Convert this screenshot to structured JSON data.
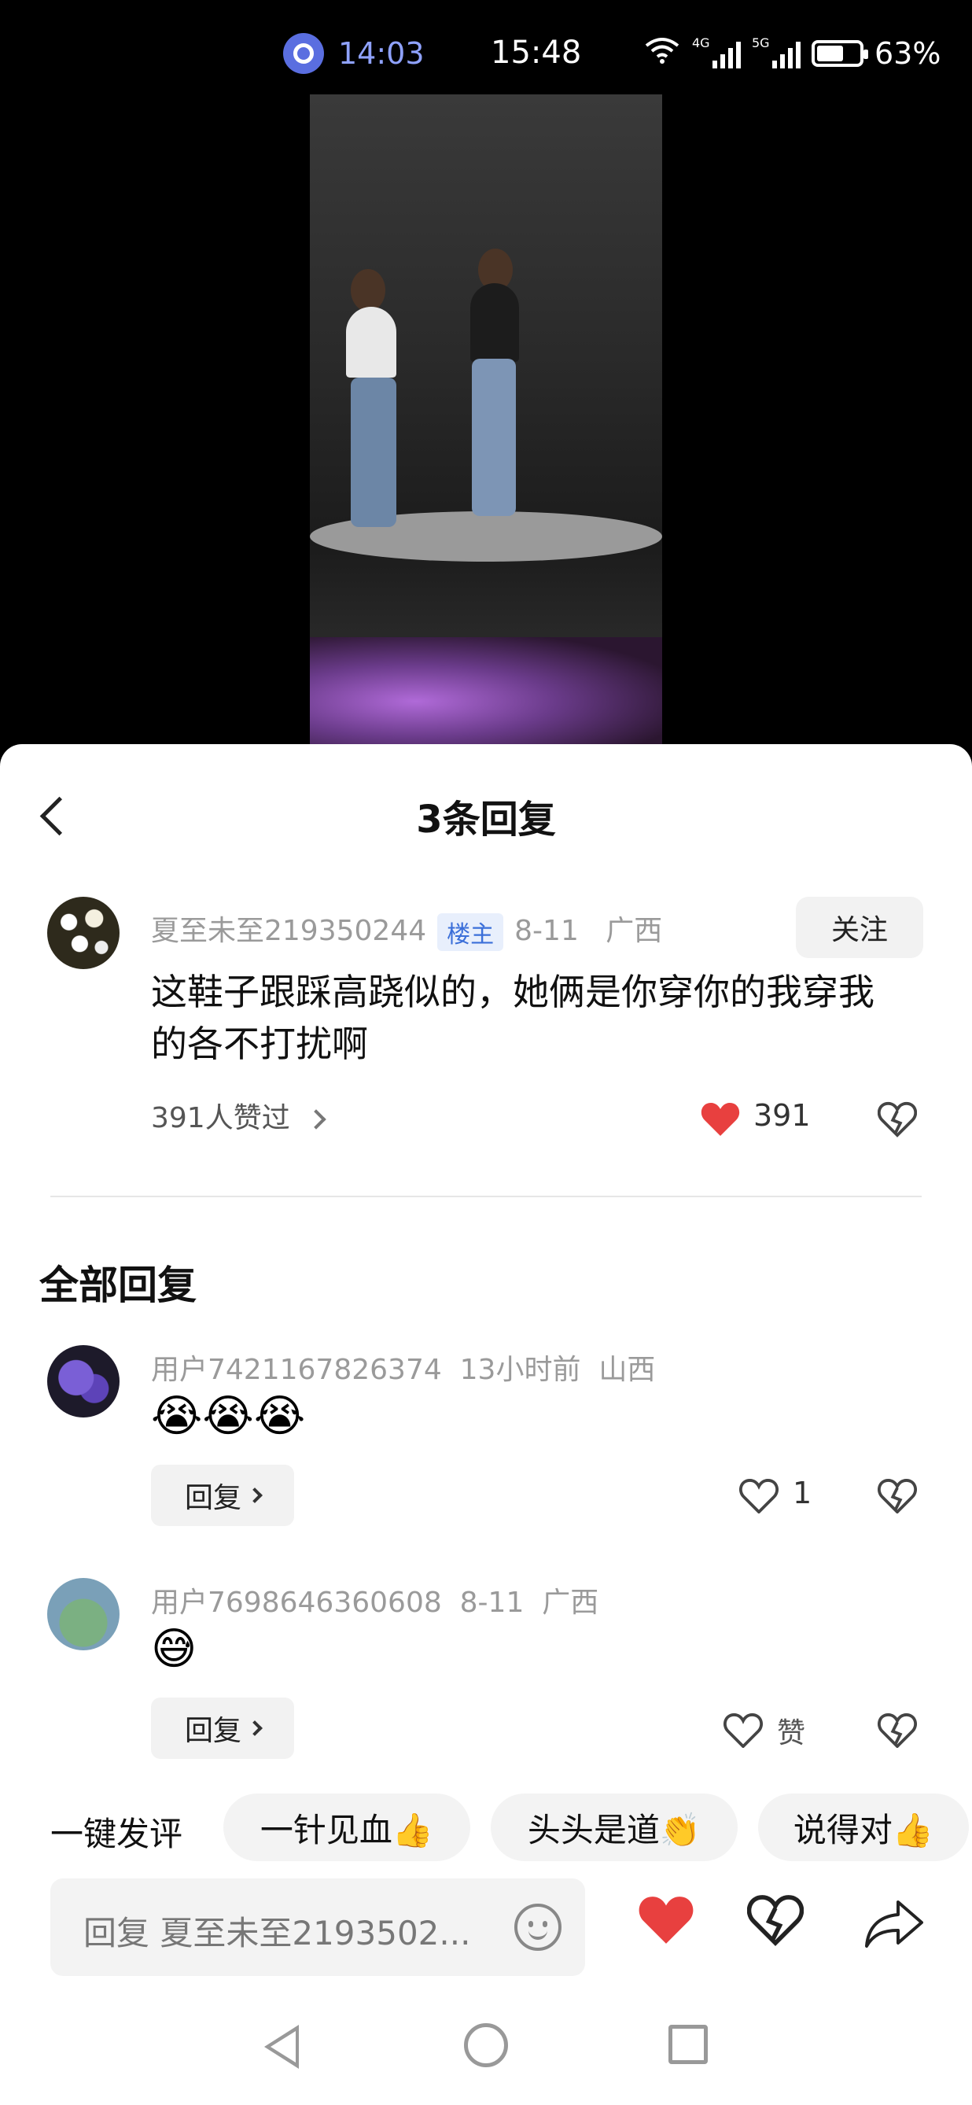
{
  "status_bar": {
    "call_time": "14:03",
    "time": "15:48",
    "network_1": "4G",
    "network_2": "5G",
    "battery": "63%",
    "battery_level": 0.63
  },
  "sheet": {
    "title": "3条回复",
    "parent_comment": {
      "username": "夏至未至219350244",
      "badge": "楼主",
      "date": "8-11",
      "location": "广西",
      "follow_label": "关注",
      "text": "这鞋子跟踩高跷似的，她俩是你穿你的我穿我的各不打扰啊",
      "likers_label": "391人赞过",
      "like_count": "391"
    },
    "section_title": "全部回复",
    "replies": [
      {
        "username": "用户7421167826374",
        "time": "13小时前",
        "location": "山西",
        "emoji": "😭😭😭",
        "reply_label": "回复",
        "like_count": "1"
      },
      {
        "username": "用户7698646360608",
        "time": "8-11",
        "location": "广西",
        "emoji": "😅",
        "reply_label": "回复",
        "like_label": "赞"
      }
    ],
    "quick_comment": {
      "label": "一键发评",
      "chips": [
        "一针见血👍",
        "头头是道👏",
        "说得对👍"
      ]
    },
    "input_placeholder": "回复 夏至未至2193502..."
  },
  "icons": [
    "call-icon",
    "wifi-icon",
    "signal-icon",
    "battery-icon",
    "back-icon",
    "heart-icon",
    "broken-heart-icon",
    "smile-icon",
    "share-icon",
    "nav-back-icon",
    "nav-home-icon",
    "nav-recents-icon"
  ],
  "colors": {
    "accent_red": "#e8403f",
    "badge_blue": "#3b6fd9",
    "call_blue": "#8fa2ff"
  }
}
